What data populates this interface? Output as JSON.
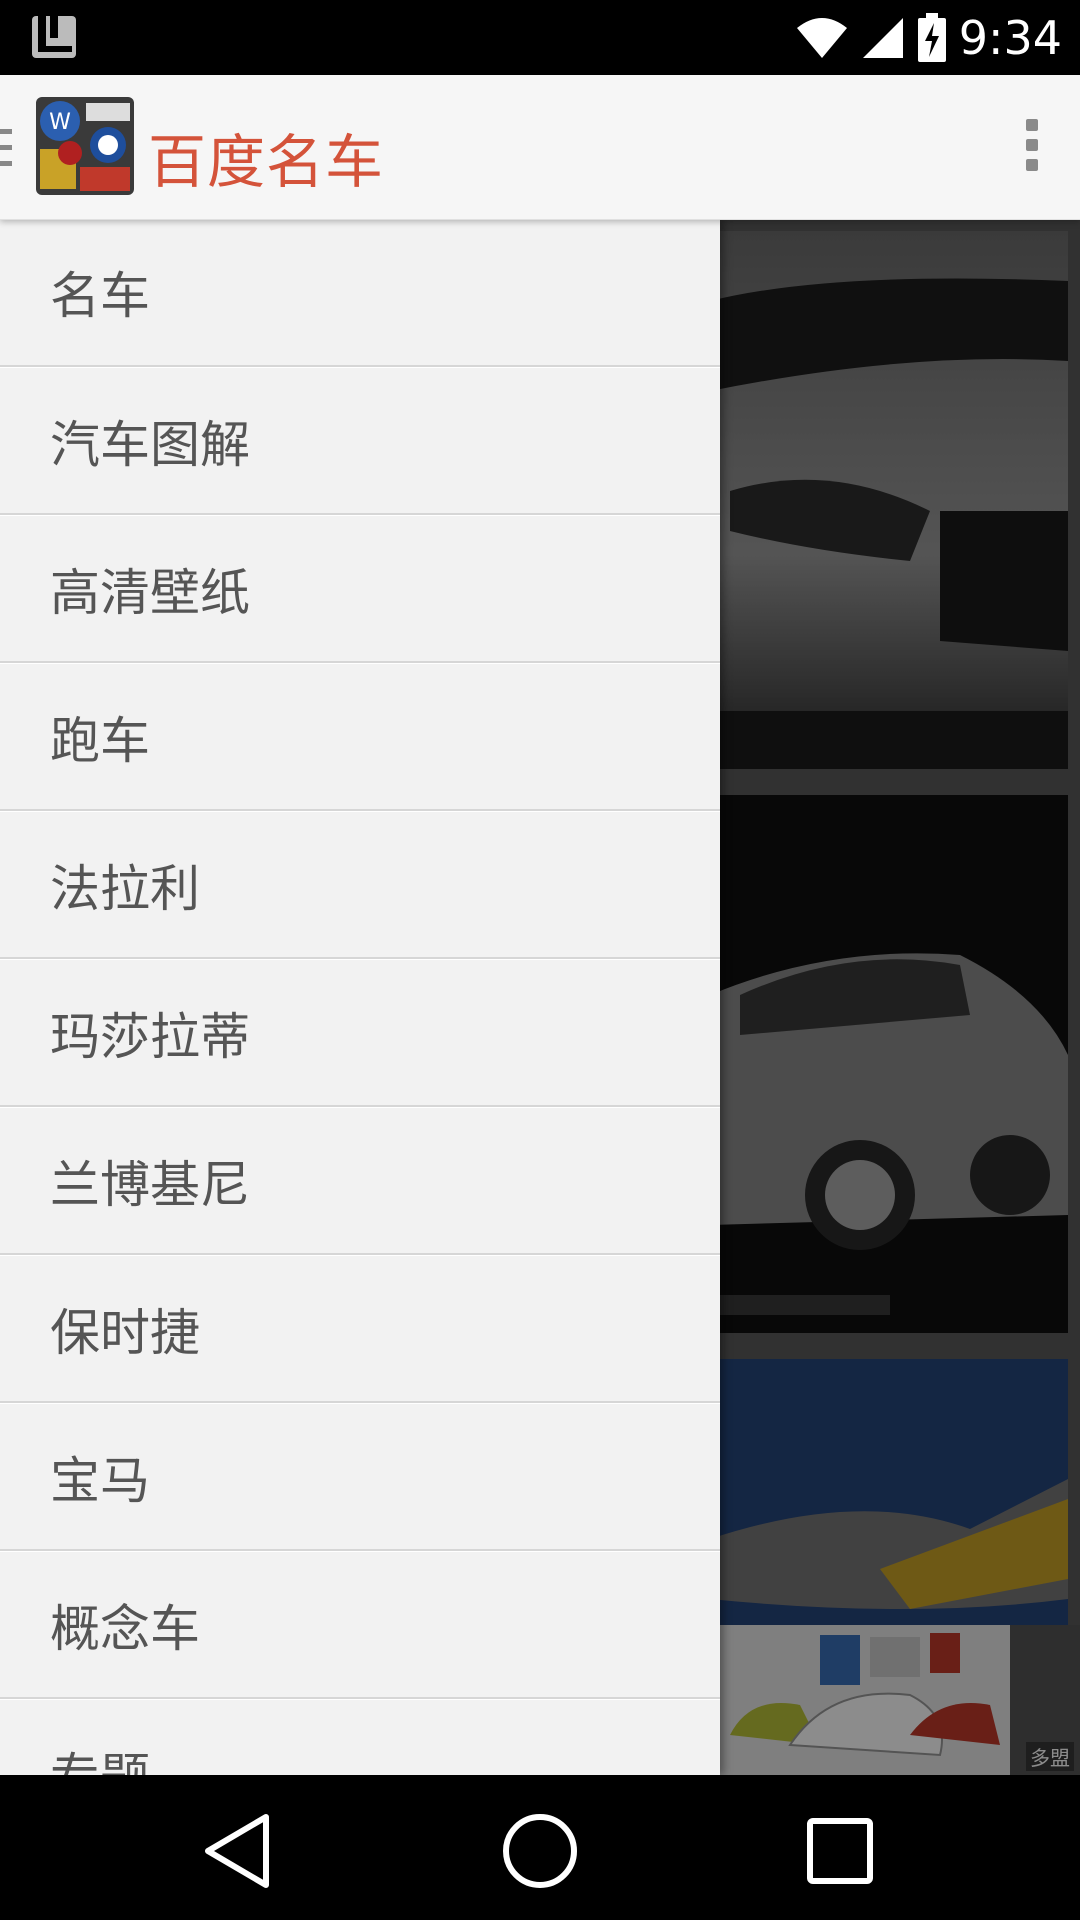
{
  "status_bar": {
    "time": "9:34",
    "icons": [
      "notification-app-icon",
      "wifi-icon",
      "signal-icon",
      "battery-charging-icon"
    ]
  },
  "app_bar": {
    "title": "百度名车",
    "logo": "car-brands-logo",
    "overflow_icon": "more-vert-icon",
    "title_color": "#d4533a"
  },
  "drawer": {
    "items": [
      {
        "label": "名车"
      },
      {
        "label": "汽车图解"
      },
      {
        "label": "高清壁纸"
      },
      {
        "label": "跑车"
      },
      {
        "label": "法拉利"
      },
      {
        "label": "玛莎拉蒂"
      },
      {
        "label": "兰博基尼"
      },
      {
        "label": "保时捷"
      },
      {
        "label": "宝马"
      },
      {
        "label": "概念车"
      },
      {
        "label": "专题"
      }
    ]
  },
  "ad": {
    "label": "多盟"
  },
  "nav_bar": {
    "buttons": [
      "back-icon",
      "home-icon",
      "recents-icon"
    ]
  }
}
